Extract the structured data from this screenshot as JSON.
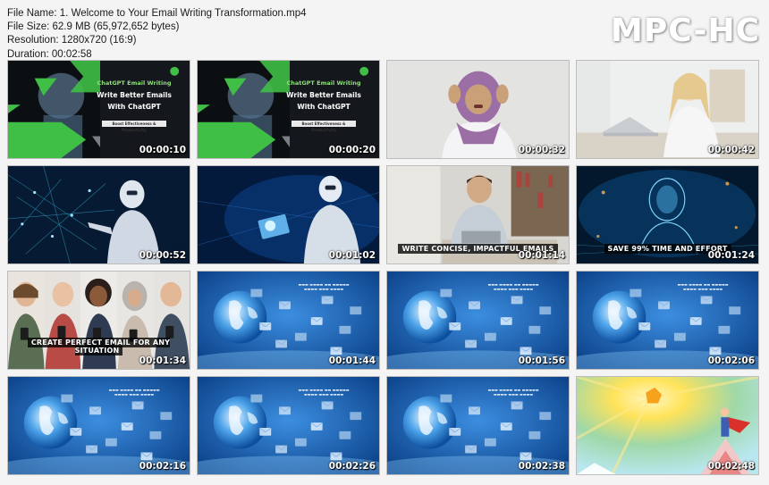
{
  "file_info": {
    "name_line": "File Name: 1. Welcome to Your Email Writing Transformation.mp4",
    "size_line": "File Size: 62.9 MB (65,972,652 bytes)",
    "resolution_line": "Resolution: 1280x720 (16:9)",
    "duration_line": "Duration: 00:02:58"
  },
  "brand": "MPC-HC",
  "slide_text": {
    "kicker": "ChatGPT Email Writing",
    "headline_1": "Write Better Emails",
    "headline_2": "With ChatGPT",
    "pill": "Boost Effectiveness & Productivity"
  },
  "thumbnails": [
    {
      "time": "00:00:10",
      "scene": "title-slide",
      "caption": ""
    },
    {
      "time": "00:00:20",
      "scene": "title-slide",
      "caption": ""
    },
    {
      "time": "00:00:32",
      "scene": "stressed-woman",
      "caption": ""
    },
    {
      "time": "00:00:42",
      "scene": "woman-laptop",
      "caption": ""
    },
    {
      "time": "00:00:52",
      "scene": "robot-network",
      "caption": ""
    },
    {
      "time": "00:01:02",
      "scene": "robot-tablet",
      "caption": ""
    },
    {
      "time": "00:01:14",
      "scene": "man-laptop",
      "caption": "WRITE CONCISE, IMPACTFUL EMAILS"
    },
    {
      "time": "00:01:24",
      "scene": "digital-head",
      "caption": "SAVE 99% TIME AND EFFORT"
    },
    {
      "time": "00:01:34",
      "scene": "people-phones",
      "caption": "CREATE PERFECT EMAIL FOR ANY SITUATION"
    },
    {
      "time": "00:01:44",
      "scene": "globe-emails",
      "caption": ""
    },
    {
      "time": "00:01:56",
      "scene": "globe-emails",
      "caption": ""
    },
    {
      "time": "00:02:06",
      "scene": "globe-emails",
      "caption": ""
    },
    {
      "time": "00:02:16",
      "scene": "globe-emails",
      "caption": ""
    },
    {
      "time": "00:02:26",
      "scene": "globe-emails",
      "caption": ""
    },
    {
      "time": "00:02:38",
      "scene": "globe-emails",
      "caption": ""
    },
    {
      "time": "00:02:48",
      "scene": "superhero-peak",
      "caption": ""
    }
  ],
  "colors": {
    "accent_green": "#3fbf46",
    "title_bg": "#0c0f12",
    "globe_bg": "#0e4f9e"
  }
}
